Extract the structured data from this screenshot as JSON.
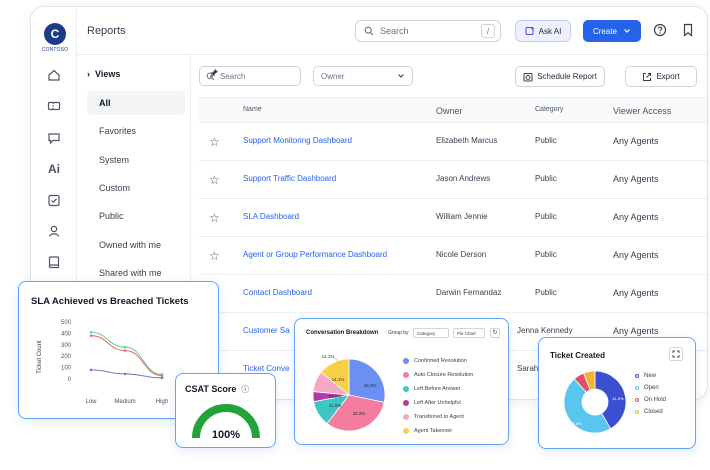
{
  "app": {
    "logo_letter": "C",
    "logo_text": "CONTOSO",
    "page_title": "Reports",
    "search_placeholder": "Search",
    "search_shortcut": "/",
    "ask_ai_label": "Ask AI",
    "create_label": "Create",
    "rail_icons": [
      "home-icon",
      "ticket-icon",
      "chat-icon",
      "ai-icon",
      "calendar-check-icon",
      "user-icon",
      "book-icon"
    ],
    "rail_ai_label": "Ai"
  },
  "views": {
    "heading": "Views",
    "items": [
      "All",
      "Favorites",
      "System",
      "Custom",
      "Public",
      "Owned with me",
      "Shared with me"
    ]
  },
  "toolbar": {
    "search_placeholder": "Search",
    "owner_filter": "Owner",
    "schedule_label": "Schedule Report",
    "export_label": "Export"
  },
  "table": {
    "columns": [
      "Name",
      "Owner",
      "Category",
      "Viewer Access"
    ],
    "rows": [
      {
        "name": "Support Monitoring Dashboard",
        "owner": "Elizabeth Marcus",
        "category": "Public",
        "access": "Any Agents"
      },
      {
        "name": "Support Traffic Dashboard",
        "owner": "Jason Andrews",
        "category": "Public",
        "access": "Any Agents"
      },
      {
        "name": "SLA Dashboard",
        "owner": "William Jennie",
        "category": "Public",
        "access": "Any Agents"
      },
      {
        "name": "Agent or Group Performance Dashboard",
        "owner": "Nicole Derson",
        "category": "Public",
        "access": "Any Agents"
      },
      {
        "name": "Contact Dashboard",
        "owner": "Darwin Fernandaz",
        "category": "Public",
        "access": "Any Agents"
      },
      {
        "name": "Customer Sa",
        "owner": "Jenna Kennedy",
        "category": "",
        "access": "Any Agents"
      },
      {
        "name": "Ticket Conve",
        "owner": "Sarah",
        "category": "",
        "access": ""
      }
    ]
  },
  "sla_card": {
    "title": "SLA Achieved vs Breached Tickets",
    "chart_data": {
      "type": "line",
      "title": "SLA Achieved vs Breached Tickets",
      "ylabel": "Ticket Count",
      "xlabel": "",
      "categories": [
        "Low",
        "Medium",
        "High"
      ],
      "yticks": [
        0,
        100,
        200,
        300,
        400,
        500
      ],
      "ylim": [
        0,
        500
      ],
      "series": [
        {
          "color": "#6ecf9b",
          "values": [
            410,
            280,
            40
          ]
        },
        {
          "color": "#e57373",
          "values": [
            380,
            250,
            30
          ]
        },
        {
          "color": "#6b7bd6",
          "values": [
            80,
            45,
            10
          ]
        }
      ]
    }
  },
  "csat_card": {
    "title": "CSAT Score",
    "value_label": "100%",
    "value": 100
  },
  "conversation_card": {
    "title": "Conversation Breakdown",
    "group_by_label": "Group by",
    "group_by_value": "Category",
    "chart_type_value": "Pie Chart",
    "chart_data": {
      "type": "pie",
      "title": "Conversation Breakdown",
      "slices": [
        {
          "label": "Confirmed Resolution",
          "value": 28.3,
          "color": "#6b8ff2"
        },
        {
          "label": "Auto Closure Resolution",
          "value": 32.2,
          "color": "#f47c9c"
        },
        {
          "label": "Left Before Answer",
          "value": 11.6,
          "color": "#3cc6c6"
        },
        {
          "label": "Left After Unhelpful",
          "value": 4.5,
          "color": "#b03aa6"
        },
        {
          "label": "Transferred to Agent",
          "value": 9.4,
          "color": "#f5a7c4"
        },
        {
          "label": "Agent Takeover",
          "value": 14.1,
          "color": "#f7d046"
        }
      ],
      "shown_labels": [
        "28.3%",
        "32.2%",
        "11.6%",
        "9.4%",
        "16.8%",
        "14.1%"
      ]
    }
  },
  "ticket_card": {
    "title": "Ticket Created",
    "chart_data": {
      "type": "pie",
      "title": "Ticket Created",
      "donut": true,
      "slices": [
        {
          "label": "New",
          "value": 41.6,
          "color": "#3b4fd1"
        },
        {
          "label": "Open",
          "value": 46.8,
          "color": "#58c6ee"
        },
        {
          "label": "On Hold",
          "value": 5.6,
          "color": "#e05161"
        },
        {
          "label": "Closed",
          "value": 6.0,
          "color": "#f3b33a"
        }
      ],
      "shown_labels": [
        "41.6%",
        "46.8%"
      ]
    }
  }
}
